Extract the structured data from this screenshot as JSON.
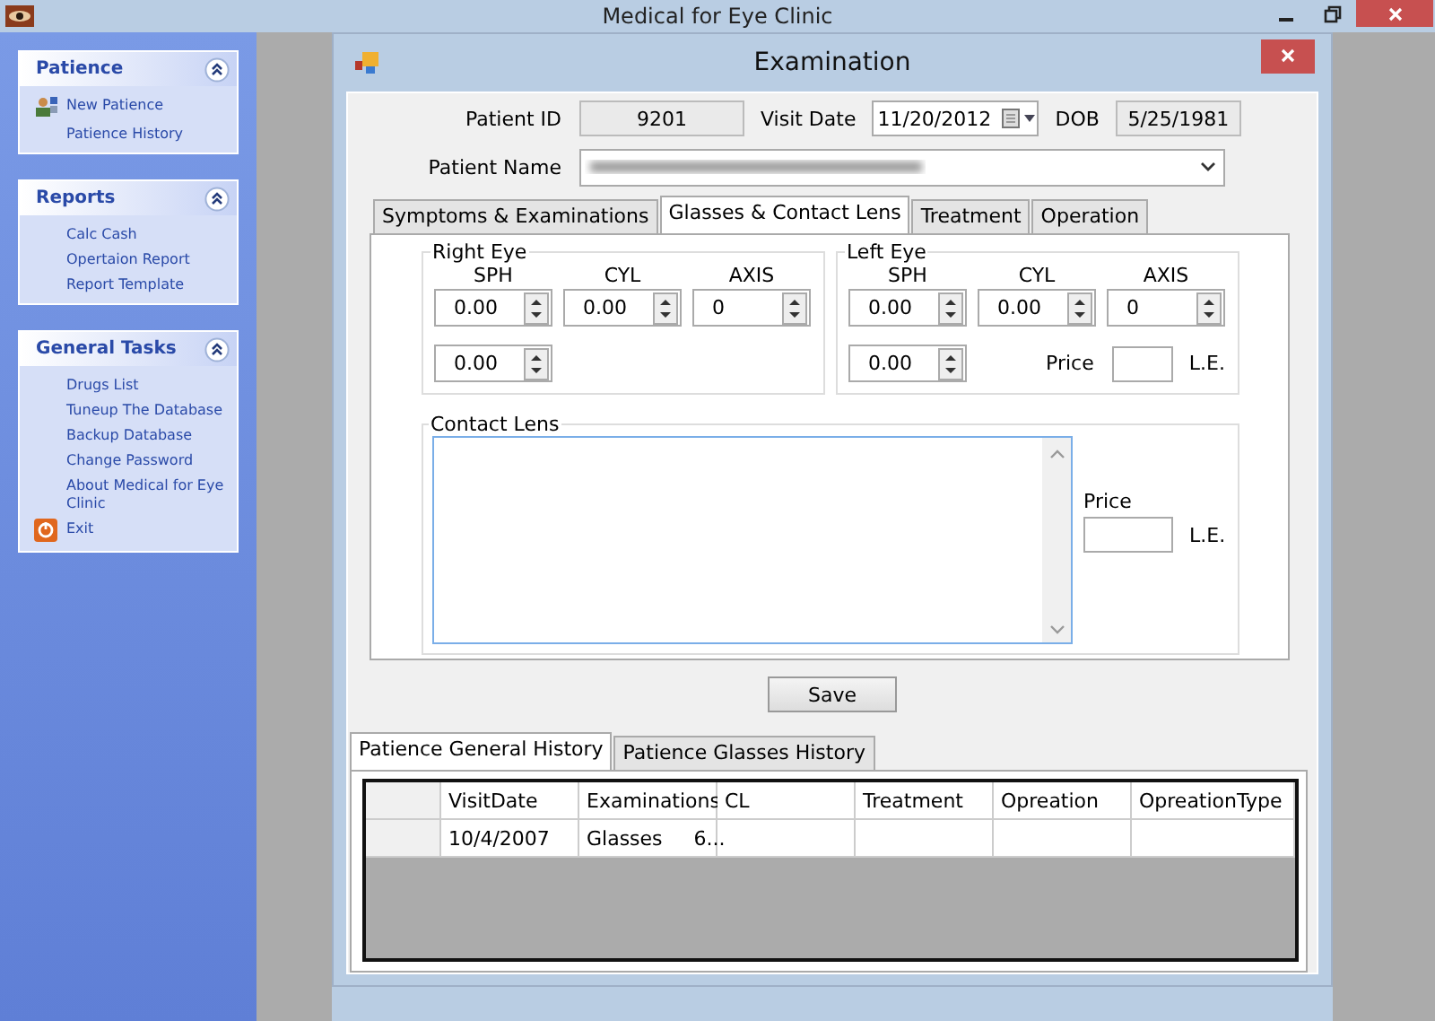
{
  "window": {
    "title": "Medical for Eye Clinic"
  },
  "sidebar": {
    "groups": [
      {
        "title": "Patience",
        "expanded": true,
        "items": [
          {
            "label": "New Patience",
            "kind": "people"
          },
          {
            "label": "Patience History",
            "kind": "plain"
          }
        ]
      },
      {
        "title": "Reports",
        "expanded": true,
        "items": [
          {
            "label": "Calc Cash",
            "kind": "plain"
          },
          {
            "label": "Opertaion Report",
            "kind": "plain"
          },
          {
            "label": "Report Template",
            "kind": "plain"
          }
        ]
      },
      {
        "title": "General Tasks",
        "expanded": true,
        "items": [
          {
            "label": "Drugs List",
            "kind": "plain"
          },
          {
            "label": "Tuneup  The Database",
            "kind": "plain"
          },
          {
            "label": "Backup Database",
            "kind": "plain"
          },
          {
            "label": "Change Password",
            "kind": "plain"
          },
          {
            "label": "About Medical for Eye Clinic",
            "kind": "plain"
          },
          {
            "label": "Exit",
            "kind": "exit"
          }
        ]
      }
    ]
  },
  "child_window": {
    "title": "Examination"
  },
  "form": {
    "patient_id_label": "Patient ID",
    "patient_id": "9201",
    "visit_date_label": "Visit Date",
    "visit_date": "11/20/2012",
    "dob_label": "DOB",
    "dob": "5/25/1981",
    "patient_name_label": "Patient Name"
  },
  "tabs": [
    {
      "label": "Symptoms & Examinations",
      "selected": false
    },
    {
      "label": "Glasses & Contact Lens",
      "selected": true
    },
    {
      "label": "Treatment",
      "selected": false
    },
    {
      "label": "Operation",
      "selected": false
    }
  ],
  "eyes": [
    {
      "title": "Right Eye",
      "columns": [
        "SPH",
        "CYL",
        "AXIS"
      ],
      "values": [
        "0.00",
        "0.00",
        "0"
      ],
      "extra": "0.00"
    },
    {
      "title": "Left Eye",
      "columns": [
        "SPH",
        "CYL",
        "AXIS"
      ],
      "values": [
        "0.00",
        "0.00",
        "0"
      ],
      "extra": "0.00",
      "price_label": "Price",
      "currency": "L.E."
    }
  ],
  "contact_lens": {
    "title": "Contact Lens",
    "price_label": "Price",
    "currency": "L.E."
  },
  "save_button": "Save",
  "history_tabs": [
    {
      "label": "Patience General History",
      "selected": true
    },
    {
      "label": "Patience Glasses History",
      "selected": false
    }
  ],
  "table": {
    "columns": [
      "VisitDate",
      "Examinations",
      "CL",
      "Treatment",
      "Opreation",
      "OpreationType"
    ],
    "rows": [
      [
        "10/4/2007",
        "Glasses     6...",
        "",
        "",
        "",
        ""
      ]
    ]
  }
}
